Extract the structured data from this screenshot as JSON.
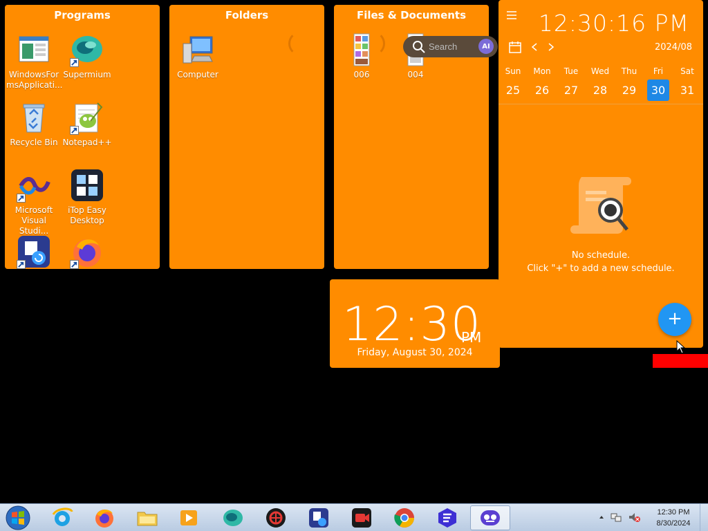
{
  "panels": {
    "programs": {
      "title": "Programs",
      "items": [
        {
          "label": "WindowsFor msApplicati...",
          "icon": "windows-forms-app-icon"
        },
        {
          "label": "Supermium",
          "icon": "supermium-icon"
        },
        {
          "label": "Recycle Bin",
          "icon": "recycle-bin-icon"
        },
        {
          "label": "Notepad++",
          "icon": "notepad-plus-plus-icon"
        },
        {
          "label": "Microsoft Visual Studi...",
          "icon": "visual-studio-icon"
        },
        {
          "label": "iTop Easy Desktop",
          "icon": "itop-easy-desktop-icon"
        },
        {
          "label": "",
          "icon": "backup-restore-icon"
        },
        {
          "label": "",
          "icon": "firefox-icon"
        }
      ]
    },
    "folders": {
      "title": "Folders",
      "items": [
        {
          "label": "Computer",
          "icon": "computer-icon"
        }
      ]
    },
    "files": {
      "title": "Files & Documents",
      "items": [
        {
          "label": "006",
          "icon": "image-file-icon"
        },
        {
          "label": "004",
          "icon": "image-file-icon"
        }
      ]
    }
  },
  "search": {
    "placeholder": "Search",
    "ai_label": "AI"
  },
  "calendar": {
    "time": "12:30:16 PM",
    "month": "2024/08",
    "day_names": [
      "Sun",
      "Mon",
      "Tue",
      "Wed",
      "Thu",
      "Fri",
      "Sat"
    ],
    "dates": [
      "25",
      "26",
      "27",
      "28",
      "29",
      "30",
      "31"
    ],
    "selected_date": "30",
    "empty_title": "No schedule.",
    "empty_hint": "Click \"+\" to add a new schedule.",
    "add_label": "+"
  },
  "clock_widget": {
    "time": "12:30",
    "ampm": "PM",
    "date": "Friday, August 30, 2024"
  },
  "taskbar": {
    "apps": [
      "internet-explorer-icon",
      "firefox-icon",
      "file-explorer-icon",
      "media-player-icon",
      "supermium-icon",
      "game-booster-icon",
      "backup-restore-icon",
      "screen-recorder-icon",
      "chrome-icon",
      "vpn-icon",
      "itop-easy-desktop-icon"
    ],
    "clock_time": "12:30 PM",
    "clock_date": "8/30/2024"
  },
  "colors": {
    "panel": "#ff8c00",
    "accent": "#1e88e5",
    "fab": "#2196f3",
    "alert": "#ff0000"
  }
}
